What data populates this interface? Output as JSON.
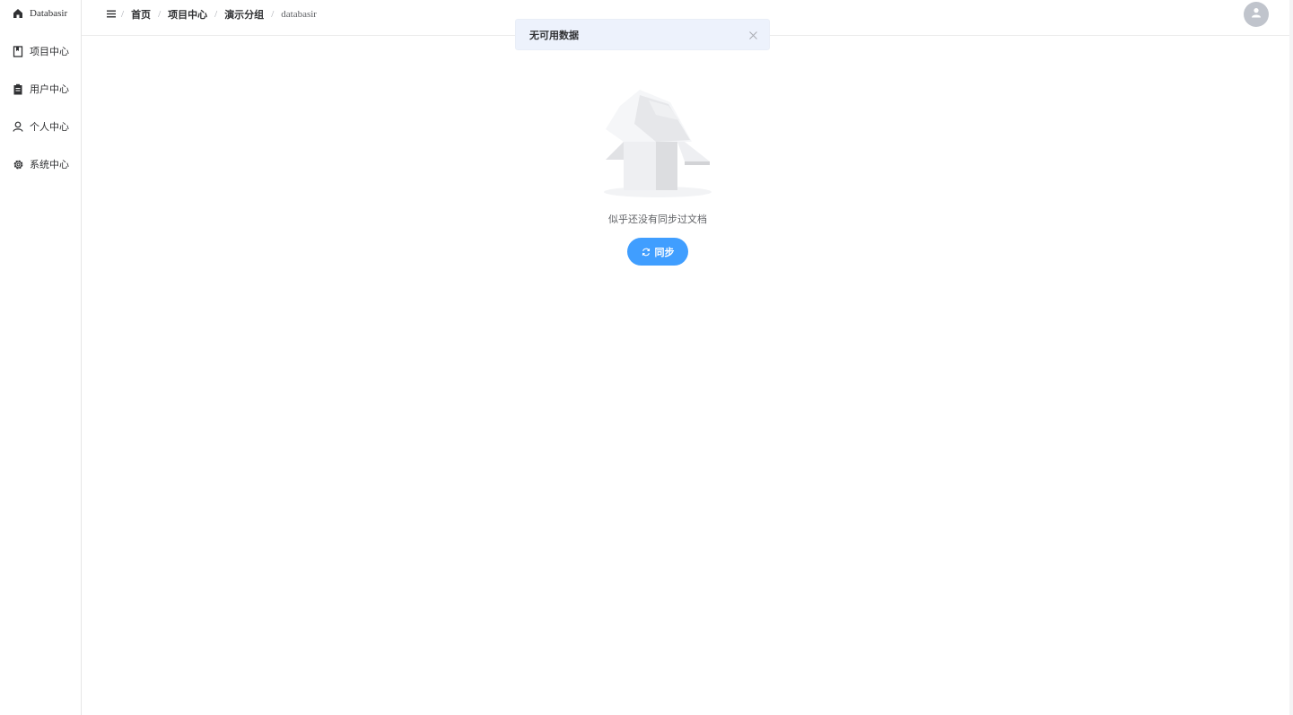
{
  "sidebar": {
    "items": [
      {
        "label": "Databasir",
        "icon": "home-icon"
      },
      {
        "label": "项目中心",
        "icon": "bookmark-icon"
      },
      {
        "label": "用户中心",
        "icon": "clipboard-icon"
      },
      {
        "label": "个人中心",
        "icon": "user-icon"
      },
      {
        "label": "系统中心",
        "icon": "gear-icon"
      }
    ]
  },
  "header": {
    "menu_icon": "menu-icon",
    "breadcrumb": [
      "首页",
      "项目中心",
      "演示分组",
      "databasir"
    ],
    "separator": "/",
    "avatar_icon": "user-avatar-icon"
  },
  "notification": {
    "message": "无可用数据",
    "close_icon": "close-icon"
  },
  "empty_state": {
    "illustration": "empty-box-illustration",
    "description": "似乎还没有同步过文档",
    "button_label": "同步",
    "button_icon": "refresh-icon"
  },
  "colors": {
    "primary": "#409eff",
    "notice_bg": "#edf2fc",
    "avatar_bg": "#c0c4cc"
  }
}
